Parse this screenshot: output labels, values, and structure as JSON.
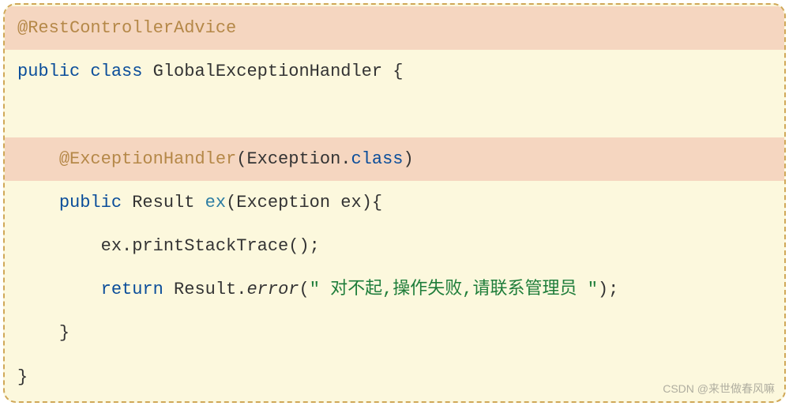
{
  "code": {
    "line1": {
      "annotation": "@RestControllerAdvice"
    },
    "line2": {
      "kw_public": "public",
      "kw_class": "class",
      "classname": " GlobalExceptionHandler ",
      "brace": "{"
    },
    "line3": {
      "indent": "    ",
      "annotation": "@ExceptionHandler",
      "paren_open": "(",
      "param": "Exception.",
      "kw_classref": "class",
      "paren_close": ")"
    },
    "line4": {
      "indent": "    ",
      "kw_public": "public",
      "returntype": " Result ",
      "method": "ex",
      "params": "(Exception ex){"
    },
    "line5": {
      "indent": "        ",
      "stmt": "ex.printStackTrace();"
    },
    "line6": {
      "indent": "        ",
      "kw_return": "return",
      "obj": " Result.",
      "method": "error",
      "paren_open": "(",
      "str": "\" 对不起,操作失败,请联系管理员 \"",
      "paren_close": ");"
    },
    "line7": {
      "indent": "    ",
      "brace": "}"
    },
    "line8": {
      "brace": "}"
    }
  },
  "watermark": "CSDN @来世做春风嘛"
}
